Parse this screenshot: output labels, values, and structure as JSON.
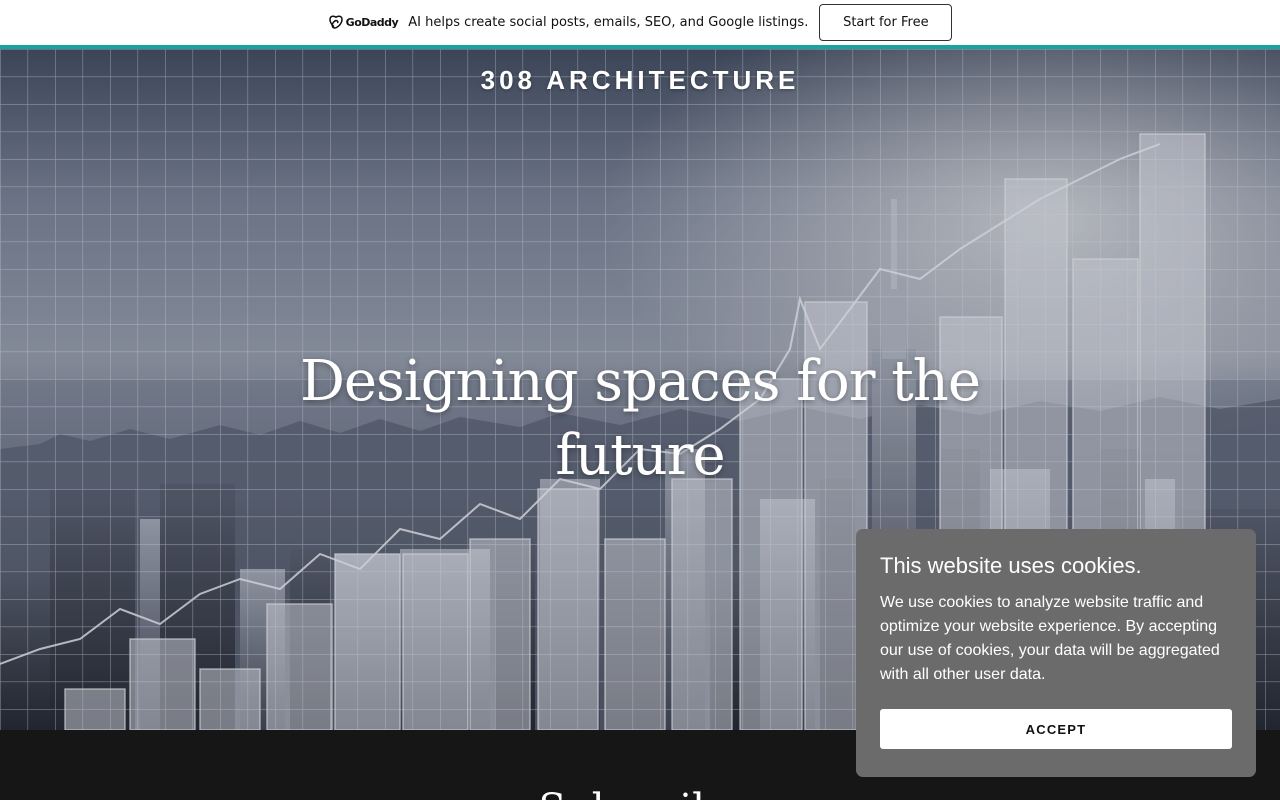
{
  "promo": {
    "logo_text": "GoDaddy",
    "message": "AI helps create social posts, emails, SEO, and Google listings.",
    "cta_label": "Start for Free",
    "accent_color": "#19a3a0"
  },
  "site": {
    "title": "308 ARCHITECTURE"
  },
  "hero": {
    "heading": "Designing spaces for the future",
    "image": "city-skyline-with-grid-and-bar-chart-overlay"
  },
  "subscribe": {
    "heading": "Subscribe"
  },
  "cookie_dialog": {
    "title": "This website uses cookies.",
    "body": "We use cookies to analyze website traffic and optimize your website experience. By accepting our use of cookies, your data will be aggregated with all other user data.",
    "accept_label": "ACCEPT",
    "background": "#6b6b6b"
  }
}
